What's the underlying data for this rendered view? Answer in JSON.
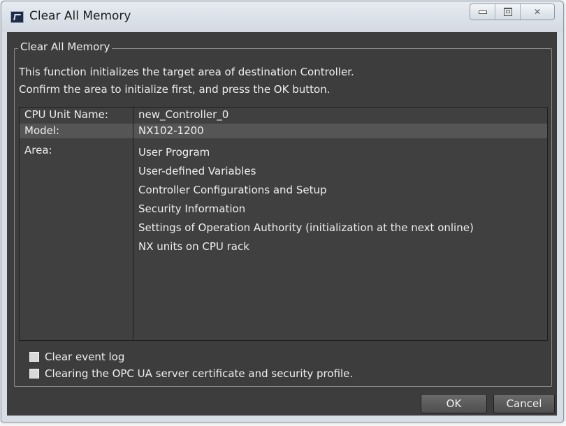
{
  "window": {
    "title": "Clear All Memory",
    "controls": {
      "minimize": "minimize-icon",
      "maximize": "maximize-icon",
      "close": "close-icon"
    }
  },
  "group": {
    "legend": "Clear All Memory",
    "description_line1": "This function initializes the target area of destination Controller.",
    "description_line2": "Confirm the area to initialize first, and press the OK button."
  },
  "info": {
    "cpu_unit_name_label": "CPU Unit Name:",
    "cpu_unit_name_value": "new_Controller_0",
    "model_label": "Model:",
    "model_value": "NX102-1200",
    "area_label": "Area:",
    "areas": [
      "User Program",
      "User-defined Variables",
      "Controller Configurations and Setup",
      "Security Information",
      "Settings of Operation Authority (initialization at the next online)",
      "NX units on CPU rack"
    ]
  },
  "options": {
    "clear_event_log": "Clear event log",
    "clear_opc_ua": "Clearing the OPC UA server certificate and security profile."
  },
  "buttons": {
    "ok": "OK",
    "cancel": "Cancel"
  }
}
